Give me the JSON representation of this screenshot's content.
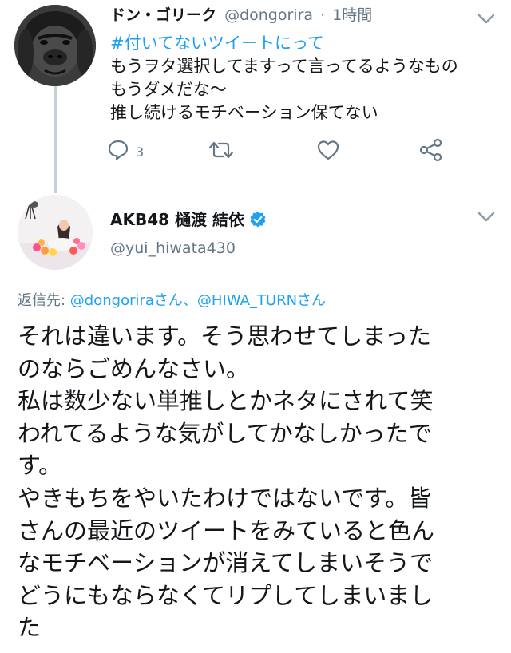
{
  "reply_tweet": {
    "display_name": "ドン・ゴリーク",
    "handle": "@dongorira",
    "separator": "·",
    "time": "1時間",
    "hashtag": "#付いてないツイートにって",
    "lines": [
      "もうヲタ選択してますって言ってるようなもの",
      "もうダメだな～",
      "推し続けるモチベーション保てない"
    ],
    "reply_count": "3",
    "avatar_icon": "gorilla-avatar"
  },
  "main_tweet": {
    "display_name": "AKB48 樋渡 結依",
    "handle": "@yui_hiwata430",
    "verified": true,
    "avatar_icon": "profile-photo-avatar",
    "replying_to": {
      "prefix": "返信先: ",
      "mention1": "@dongorira",
      "suffix1": "さん、",
      "mention2": "@HIWA_TURN",
      "suffix2": "さん"
    },
    "body_lines": [
      "それは違います。そう思わせてしまった",
      "のならごめんなさい。",
      "私は数少ない単推しとかネタにされて笑",
      "われてるような気がしてかなしかったで",
      "す。",
      "やきもちをやいたわけではないです。皆",
      "さんの最近のツイートをみていると色ん",
      "なモチベーションが消えてしまいそうで",
      "どうにもならなくてリプしてしまいまし",
      "た"
    ]
  },
  "colors": {
    "link": "#1da1f2",
    "secondary_text": "#657786",
    "primary_text": "#14171a",
    "icon_gray": "#657786",
    "thread_line": "#c4cfd6"
  }
}
